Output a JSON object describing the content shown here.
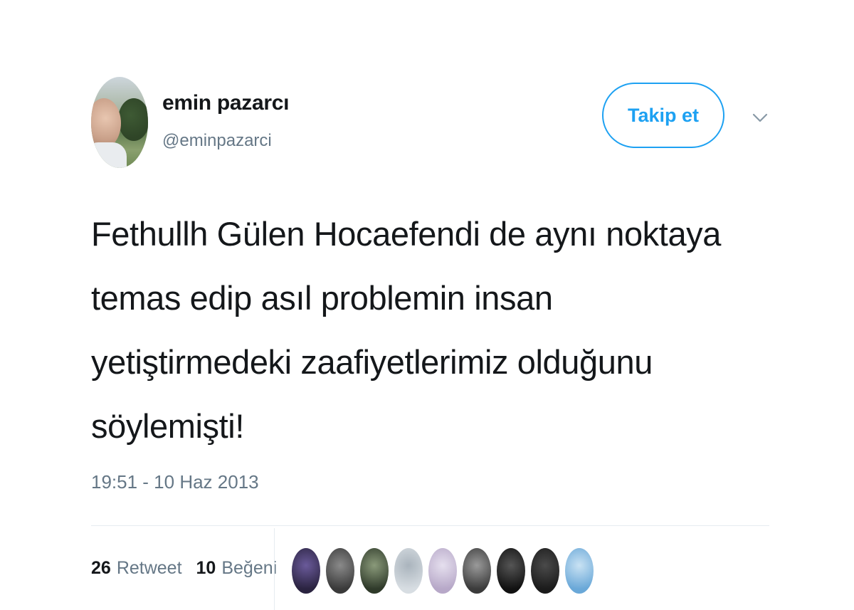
{
  "user": {
    "display_name": "emin pazarcı",
    "handle": "@eminpazarci"
  },
  "follow_button_label": "Takip et",
  "tweet": {
    "lines": [
      "Fethullh Gülen Hocaefendi de aynı noktaya",
      "temas edip asıl problemin insan",
      "yetiştirmedeki zaafiyetlerimiz olduğunu",
      "söylemişti!"
    ],
    "timestamp": "19:51 - 10 Haz 2013"
  },
  "stats": {
    "retweet_count": "26",
    "retweet_label": "Retweet",
    "like_count": "10",
    "like_label": "Beğeni"
  },
  "colors": {
    "accent": "#1da1f2",
    "secondary_text": "#657786",
    "primary_text": "#14171a",
    "divider": "#e6ecf0"
  },
  "liker_avatar_colors": [
    [
      "#2a2340",
      "#6a5a9a"
    ],
    [
      "#3a3a3a",
      "#8a8a8a"
    ],
    [
      "#2f3a2a",
      "#8a9a7a"
    ],
    [
      "#d7dde2",
      "#aab4bd"
    ],
    [
      "#b7a8c8",
      "#e5dfee"
    ],
    [
      "#3b3b3b",
      "#9a9a9a"
    ],
    [
      "#111111",
      "#555555"
    ],
    [
      "#1b1b1b",
      "#4a4a4a"
    ],
    [
      "#6aa8d8",
      "#c9e2f3"
    ]
  ]
}
